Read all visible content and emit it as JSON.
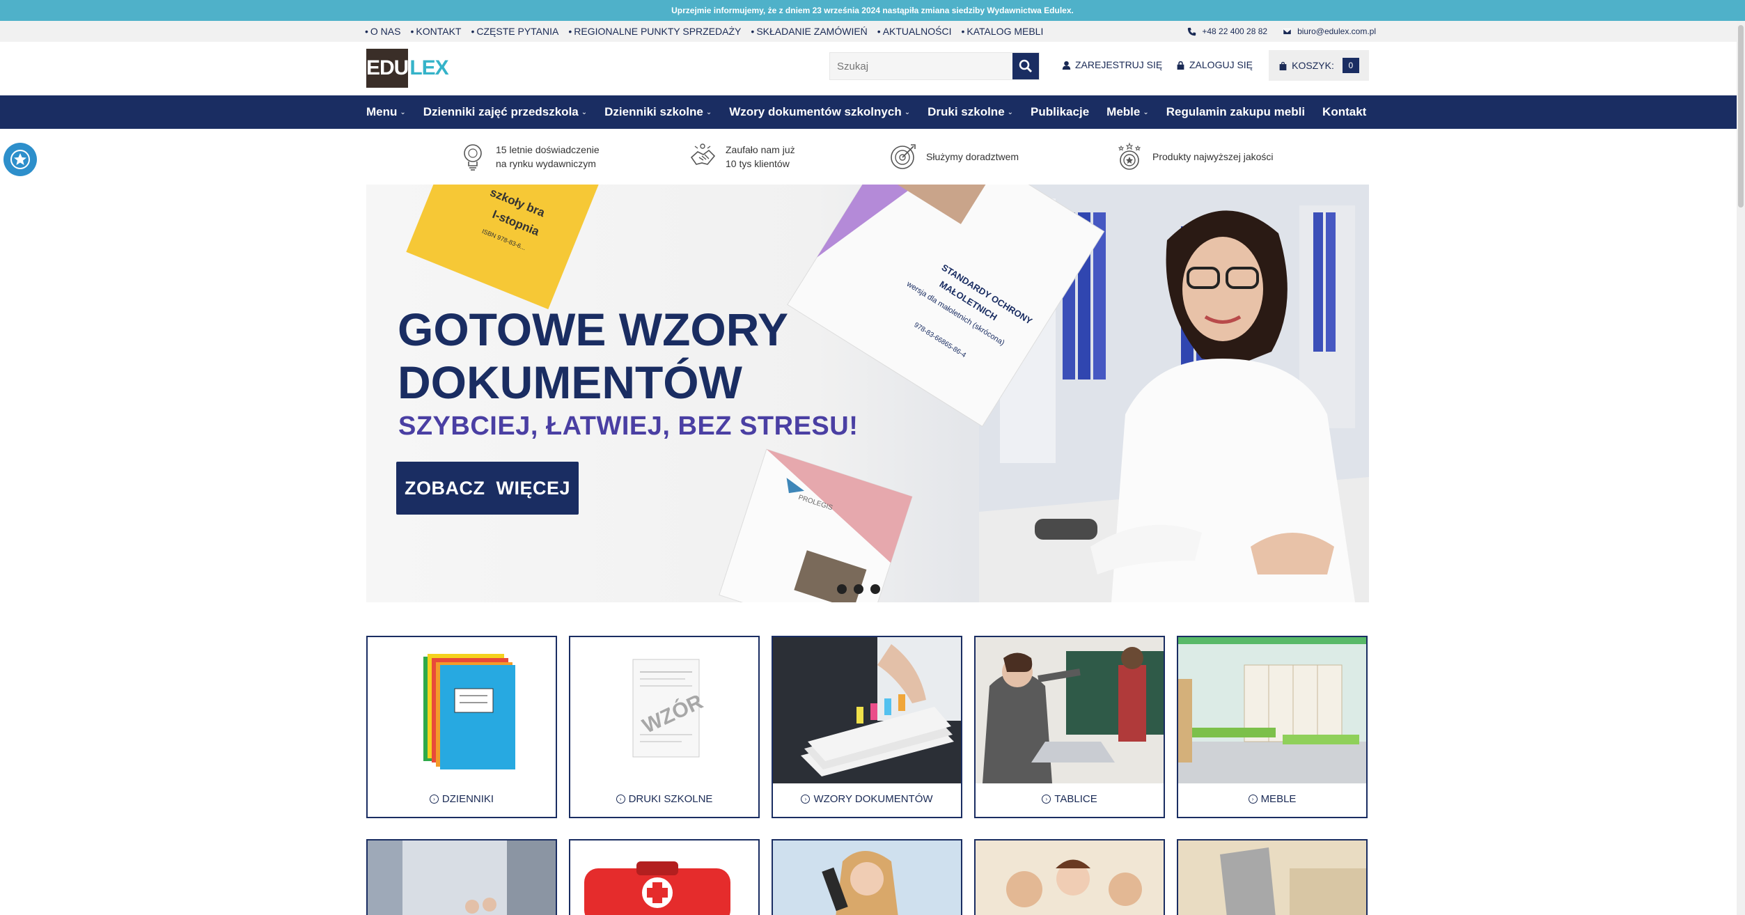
{
  "notice": "Uprzejmie informujemy, że z dniem 23 września 2024 nastąpiła zmiana siedziby Wydawnictwa Edulex.",
  "top_links": [
    "O NAS",
    "KONTAKT",
    "CZĘSTE PYTANIA",
    "REGIONALNE PUNKTY SPRZEDAŻY",
    "SKŁADANIE ZAMÓWIEŃ",
    "AKTUALNOŚCI",
    "KATALOG MEBLI"
  ],
  "contact": {
    "phone": "+48 22 400 28 82",
    "email": "biuro@edulex.com.pl"
  },
  "logo": {
    "edu": "EDU",
    "lex": "LEX"
  },
  "search": {
    "placeholder": "Szukaj"
  },
  "header": {
    "register": "ZAREJESTRUJ SIĘ",
    "login": "ZALOGUJ SIĘ",
    "cart_label": "KOSZYK:",
    "cart_count": "0"
  },
  "nav": [
    {
      "label": "Menu",
      "dropdown": true
    },
    {
      "label": "Dzienniki zajęć przedszkola",
      "dropdown": true
    },
    {
      "label": "Dzienniki szkolne",
      "dropdown": true
    },
    {
      "label": "Wzory dokumentów szkolnych",
      "dropdown": true
    },
    {
      "label": "Druki szkolne",
      "dropdown": true
    },
    {
      "label": "Publikacje",
      "dropdown": false
    },
    {
      "label": "Meble",
      "dropdown": true
    },
    {
      "label": "Regulamin zakupu mebli",
      "dropdown": false
    },
    {
      "label": "Kontakt",
      "dropdown": false
    }
  ],
  "features": [
    {
      "line1": "15 letnie doświadczenie",
      "line2": "na rynku wydawniczym",
      "icon": "lightbulb-icon"
    },
    {
      "line1": "Zaufało nam już",
      "line2": "10 tys klientów",
      "icon": "handshake-icon"
    },
    {
      "line1": "Służymy doradztwem",
      "line2": "",
      "icon": "target-icon"
    },
    {
      "line1": "Produkty najwyższej jakości",
      "line2": "",
      "icon": "quality-badge-icon"
    }
  ],
  "hero": {
    "title_line1": "GOTOWE WZORY",
    "title_line2": "DOKUMENTÓW",
    "subtitle": "SZYBCIEJ, ŁATWIEJ, BEZ STRESU!",
    "button": "ZOBACZ  WIĘCEJ",
    "book1_lines": [
      "szkoły bra",
      "I-stopnia",
      "ISBN 978-83-6..."
    ],
    "book2_lines": [
      "STANDARDY OCHRONY",
      "MAŁOLETNICH",
      "wersja dla małoletnich (skrócona)",
      "978-83-66865-86-4"
    ],
    "brand": "PROLEGIS"
  },
  "categories": [
    {
      "label": "DZIENNIKI",
      "image": "colored-notebooks"
    },
    {
      "label": "DRUKI SZKOLNE",
      "image": "form-wzor",
      "stamp": "WZÓR"
    },
    {
      "label": "WZORY DOKUMENTÓW",
      "image": "document-stack"
    },
    {
      "label": "TABLICE",
      "image": "classroom-board"
    },
    {
      "label": "MEBLE",
      "image": "classroom-furniture"
    }
  ],
  "colors": {
    "navy": "#1a2d62",
    "teal": "#4fb1c9",
    "purple": "#4a3fa3"
  }
}
